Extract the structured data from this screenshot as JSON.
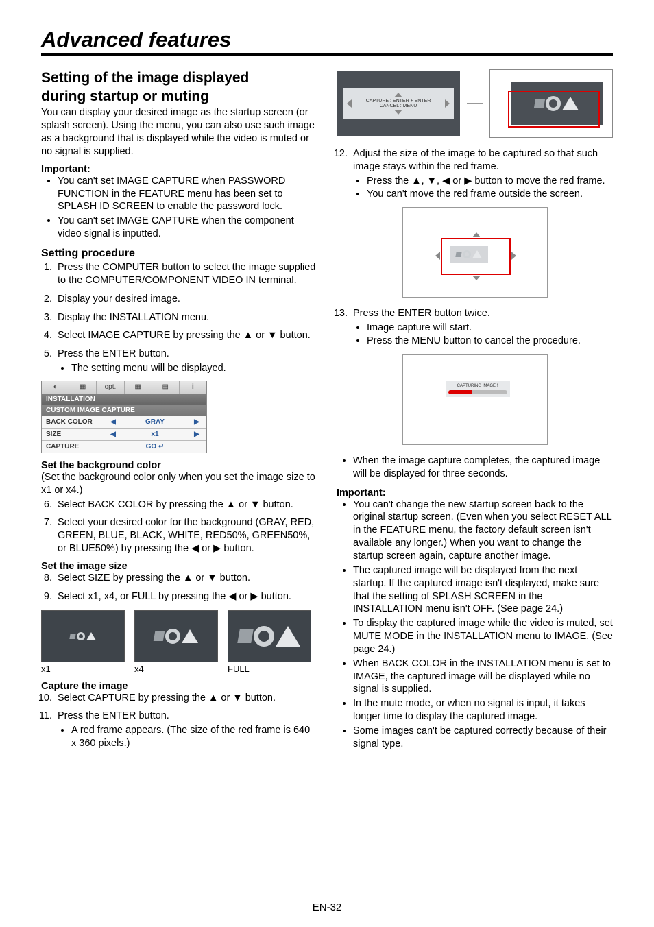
{
  "title": "Advanced features",
  "footer": "EN-32",
  "left": {
    "h2a": "Setting of the image displayed",
    "h2b": "during startup or muting",
    "intro": "You can display your desired image as the startup screen (or splash screen). Using the menu, you can also use such image as a background that is displayed while the video is muted or no signal is supplied.",
    "imp_label": "Important:",
    "imp1": "You can't set IMAGE CAPTURE when PASSWORD FUNCTION in the FEATURE menu has been set to SPLASH ID SCREEN to enable the password lock.",
    "imp2": "You can't set IMAGE CAPTURE when the component video signal is inputted.",
    "proc_h": "Setting procedure",
    "s1": "Press the COMPUTER button to select the image supplied to the COMPUTER/COMPONENT VIDEO IN terminal.",
    "s2": "Display your desired image.",
    "s3": "Display the INSTALLATION menu.",
    "s4": "Select IMAGE CAPTURE by pressing the ▲ or ▼ button.",
    "s5": "Press the ENTER button.",
    "s5a": "The setting menu will be displayed.",
    "menu": {
      "header": "INSTALLATION",
      "sub": "CUSTOM IMAGE CAPTURE",
      "r1l": "BACK COLOR",
      "r1v": "GRAY",
      "r2l": "SIZE",
      "r2v": "x1",
      "r3l": "CAPTURE",
      "r3v": "GO ↵"
    },
    "bg_h": "Set the background color",
    "bg_note": "(Set the background color only when you set the image size to x1 or x4.)",
    "s6": "Select BACK COLOR by pressing the ▲ or ▼ button.",
    "s7": "Select your desired color for the background (GRAY, RED, GREEN, BLUE, BLACK, WHITE, RED50%, GREEN50%, or BLUE50%) by pressing the ◀ or ▶ button.",
    "size_h": "Set the image size",
    "s8": "Select SIZE by pressing the ▲ or ▼ button.",
    "s9": "Select x1, x4, or FULL by pressing the ◀ or ▶ button.",
    "thumb_labels": {
      "x1": "x1",
      "x4": "x4",
      "full": "FULL"
    },
    "cap_h": "Capture the image",
    "s10": "Select CAPTURE by pressing the ▲ or ▼ button.",
    "s11": "Press the ENTER button.",
    "s11a": "A red frame appears. (The size of the red frame is 640 x 360 pixels.)"
  },
  "right": {
    "cap_ctrl1": "CAPTURE : ENTER + ENTER",
    "cap_ctrl2": "CANCEL : MENU",
    "s12": "Adjust the size of the image to be captured so that such image stays within the red frame.",
    "s12a": "Press the ▲, ▼, ◀ or ▶ button to move the red frame.",
    "s12b": "You can't move the red frame outside the screen.",
    "s13": "Press the ENTER button twice.",
    "s13a": "Image capture will start.",
    "s13b": "Press the MENU button to cancel the procedure.",
    "popup": "CAPTURING IMAGE !",
    "s13c": "When the image capture completes, the captured image will be displayed for three seconds.",
    "imp_label": "Important:",
    "imp1": "You can't change the new startup screen back to the original startup screen. (Even when you select RESET ALL in the FEATURE menu, the factory default screen isn't available any longer.) When you want to change the startup screen again, capture another image.",
    "imp2": "The captured image will be displayed from the next startup. If the captured image isn't displayed, make sure that the setting of SPLASH SCREEN in the INSTALLATION menu isn't OFF. (See page 24.)",
    "imp3": "To display the captured image while the video is muted, set MUTE MODE in the INSTALLATION menu to IMAGE. (See page 24.)",
    "imp4": "When BACK COLOR in the INSTALLATION menu is set to IMAGE, the captured image will be displayed while no signal is supplied.",
    "imp5": "In the mute mode, or when no signal is input, it takes longer time to display the captured image.",
    "imp6": "Some images can't be captured correctly because of their signal type."
  }
}
